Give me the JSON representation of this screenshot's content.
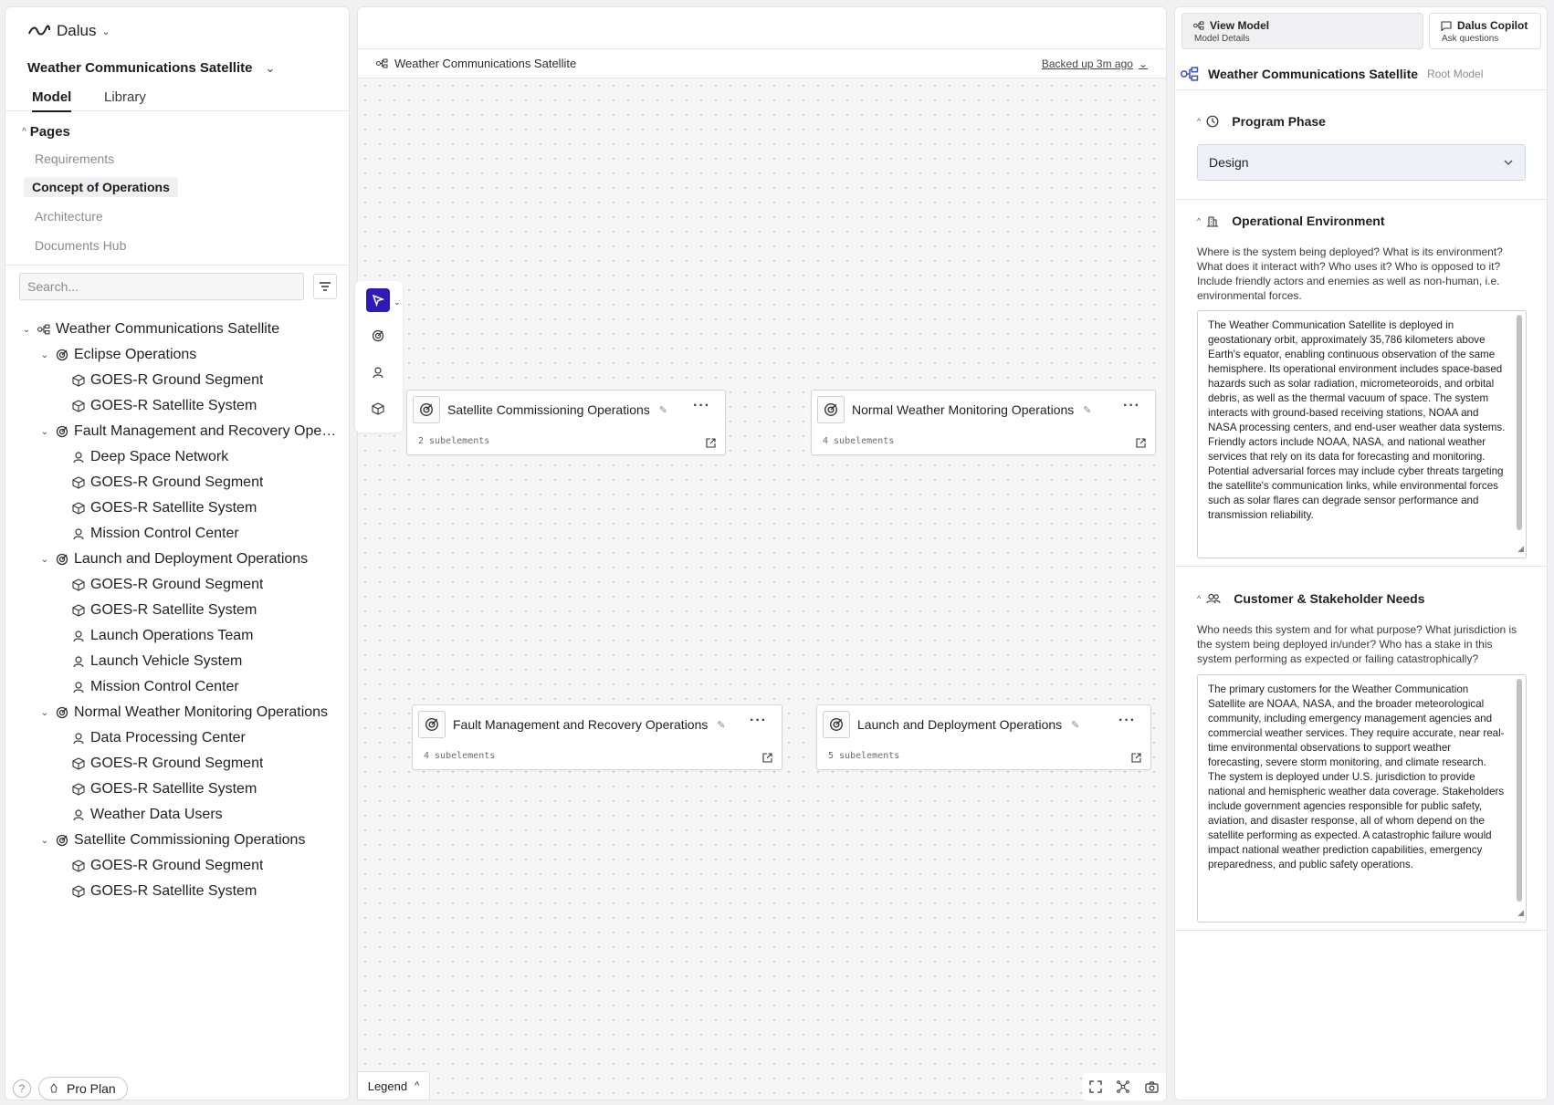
{
  "app": {
    "brand": "Dalus"
  },
  "model": {
    "title": "Weather Communications Satellite"
  },
  "left_tabs": [
    "Model",
    "Library"
  ],
  "pages": {
    "header": "Pages",
    "items": [
      "Requirements",
      "Concept of Operations",
      "Architecture",
      "Documents Hub"
    ],
    "active": "Concept of Operations"
  },
  "search": {
    "placeholder": "Search..."
  },
  "tree": {
    "root": "Weather Communications Satellite",
    "groups": [
      {
        "label": "Eclipse Operations",
        "children": [
          {
            "label": "GOES-R Ground Segment",
            "icon": "cube-icon"
          },
          {
            "label": "GOES-R Satellite System",
            "icon": "cube-icon"
          }
        ]
      },
      {
        "label": "Fault Management and Recovery Operations",
        "children": [
          {
            "label": "Deep Space Network",
            "icon": "person-icon"
          },
          {
            "label": "GOES-R Ground Segment",
            "icon": "cube-icon"
          },
          {
            "label": "GOES-R Satellite System",
            "icon": "cube-icon"
          },
          {
            "label": "Mission Control Center",
            "icon": "person-icon"
          }
        ]
      },
      {
        "label": "Launch and Deployment Operations",
        "children": [
          {
            "label": "GOES-R Ground Segment",
            "icon": "cube-icon"
          },
          {
            "label": "GOES-R Satellite System",
            "icon": "cube-icon"
          },
          {
            "label": "Launch Operations Team",
            "icon": "person-icon"
          },
          {
            "label": "Launch Vehicle System",
            "icon": "person-icon"
          },
          {
            "label": "Mission Control Center",
            "icon": "person-icon"
          }
        ]
      },
      {
        "label": "Normal Weather Monitoring Operations",
        "children": [
          {
            "label": "Data Processing Center",
            "icon": "person-icon"
          },
          {
            "label": "GOES-R Ground Segment",
            "icon": "cube-icon"
          },
          {
            "label": "GOES-R Satellite System",
            "icon": "cube-icon"
          },
          {
            "label": "Weather Data Users",
            "icon": "person-icon"
          }
        ]
      },
      {
        "label": "Satellite Commissioning Operations",
        "children": [
          {
            "label": "GOES-R Ground Segment",
            "icon": "cube-icon"
          },
          {
            "label": "GOES-R Satellite System",
            "icon": "cube-icon"
          }
        ]
      }
    ]
  },
  "footer": {
    "help": "?",
    "plan": "Pro Plan"
  },
  "canvas": {
    "breadcrumb": "Weather Communications Satellite",
    "backup_status": "Backed up 3m ago",
    "legend": "Legend",
    "nodes": [
      {
        "title": "Satellite Commissioning Operations",
        "sub": "2 subelements"
      },
      {
        "title": "Normal Weather Monitoring Operations",
        "sub": "4 subelements"
      },
      {
        "title": "Fault Management and Recovery Operations",
        "sub": "4 subelements"
      },
      {
        "title": "Launch and Deployment Operations",
        "sub": "5 subelements"
      }
    ]
  },
  "right_panel": {
    "tabs": [
      {
        "title": "View Model",
        "subtitle": "Model Details"
      },
      {
        "title": "Dalus Copilot",
        "subtitle": "Ask questions"
      }
    ],
    "root_name": "Weather Communications Satellite",
    "root_tag": "Root Model",
    "program_phase": {
      "label": "Program Phase",
      "value": "Design"
    },
    "operational_environment": {
      "label": "Operational Environment",
      "prompt": "Where is the system being deployed? What is its environment? What does it interact with? Who uses it? Who is opposed to it? Include friendly actors and enemies as well as non-human, i.e. environmental forces.",
      "text": "The Weather Communication Satellite is deployed in geostationary orbit, approximately 35,786 kilometers above Earth's equator, enabling continuous observation of the same hemisphere. Its operational environment includes space-based hazards such as solar radiation, micrometeoroids, and orbital debris, as well as the thermal vacuum of space. The system interacts with ground-based receiving stations, NOAA and NASA processing centers, and end-user weather data systems. Friendly actors include NOAA, NASA, and national weather services that rely on its data for forecasting and monitoring. Potential adversarial forces may include cyber threats targeting the satellite's communication links, while environmental forces such as solar flares can degrade sensor performance and transmission reliability."
    },
    "stakeholder_needs": {
      "label": "Customer & Stakeholder Needs",
      "prompt": "Who needs this system and for what purpose? What jurisdiction is the system being deployed in/under? Who has a stake in this system performing as expected or failing catastrophically?",
      "text": "The primary customers for the Weather Communication Satellite are NOAA, NASA, and the broader meteorological community, including emergency management agencies and commercial weather services. They require accurate, near real-time environmental observations to support weather forecasting, severe storm monitoring, and climate research. The system is deployed under U.S. jurisdiction to provide national and hemispheric weather data coverage. Stakeholders include government agencies responsible for public safety, aviation, and disaster response, all of whom depend on the satellite performing as expected. A catastrophic failure would impact national weather prediction capabilities, emergency preparedness, and public safety operations."
    }
  },
  "colors": {
    "accent": "#2d1bb8",
    "select_bg": "#eef1f8"
  }
}
